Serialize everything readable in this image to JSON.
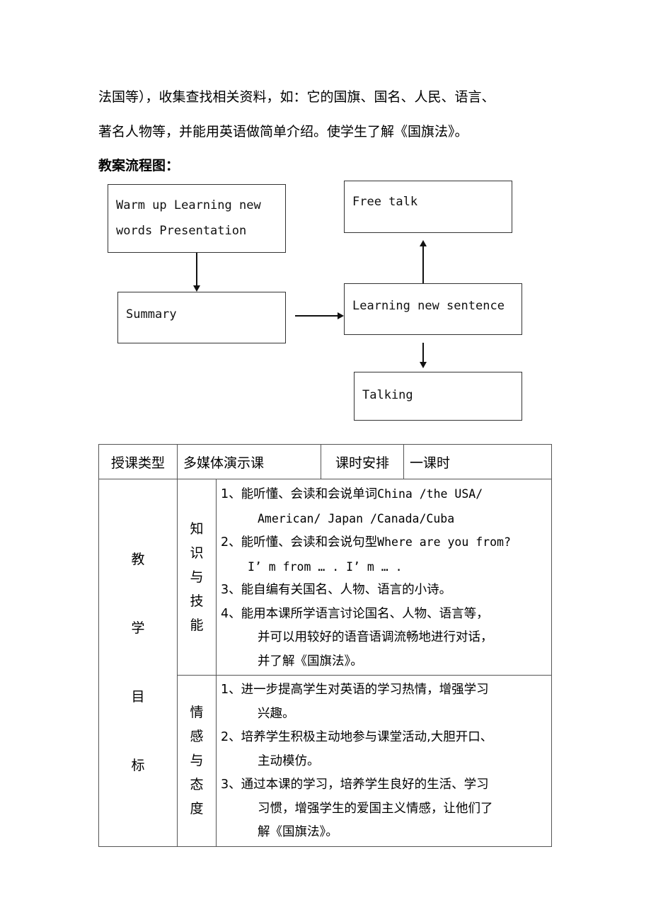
{
  "intro": {
    "line1": "法国等），收集查找相关资料，如：它的国旗、国名、人民、语言、",
    "line2": "著名人物等，并能用英语做简单介绍。使学生了解《国旗法》。",
    "flowchart_heading": "教案流程图："
  },
  "flowchart": {
    "nodes": {
      "warmup": {
        "line1": "Warm up Learning new",
        "line2": "words Presentation"
      },
      "summary": "Summary",
      "learning_sentence": "Learning new sentence",
      "free_talk": "Free talk",
      "talking": "Talking"
    },
    "edges": [
      {
        "from": "warmup",
        "to": "summary"
      },
      {
        "from": "summary",
        "to": "learning_sentence"
      },
      {
        "from": "learning_sentence",
        "to": "free_talk"
      },
      {
        "from": "learning_sentence",
        "to": "talking"
      }
    ]
  },
  "table": {
    "header": {
      "type_label": "授课类型",
      "type_value": "多媒体演示课",
      "schedule_label": "课时安排",
      "schedule_value": "一课时"
    },
    "objectives_label": [
      "教",
      "学",
      "目",
      "标"
    ],
    "knowledge": {
      "label": [
        "知",
        "识",
        "与",
        "技",
        "能"
      ],
      "items": [
        {
          "prefix": "1、能听懂、会读和会说单词",
          "en": "China /the USA/",
          "cont": "American/ Japan /Canada/Cuba"
        },
        {
          "prefix": "2、能听懂、会读和会说句型",
          "en": "Where are you from?",
          "cont": "I’ m from … . I’ m … ."
        },
        {
          "prefix": "3、能自编有关国名、人物、语言的小诗。"
        },
        {
          "prefix": "4、能用本课所学语言讨论国名、人物、语言等，",
          "cont_lines": [
            "并可以用较好的语音语调流畅地进行对话，",
            "并了解《国旗法》。"
          ]
        }
      ]
    },
    "emotion": {
      "label": [
        "情",
        "感",
        "与",
        "态",
        "度"
      ],
      "items": [
        {
          "prefix": "1、进一步提高学生对英语的学习热情，增强学习",
          "cont_lines": [
            "兴趣。"
          ]
        },
        {
          "prefix": "2、培养学生积极主动地参与课堂活动,大胆开口、",
          "cont_lines": [
            "主动模仿。"
          ]
        },
        {
          "prefix": "3、通过本课的学习，培养学生良好的生活、学习",
          "cont_lines": [
            "习惯，增强学生的爱国主义情感，让他们了",
            "解《国旗法》。"
          ]
        }
      ]
    }
  }
}
